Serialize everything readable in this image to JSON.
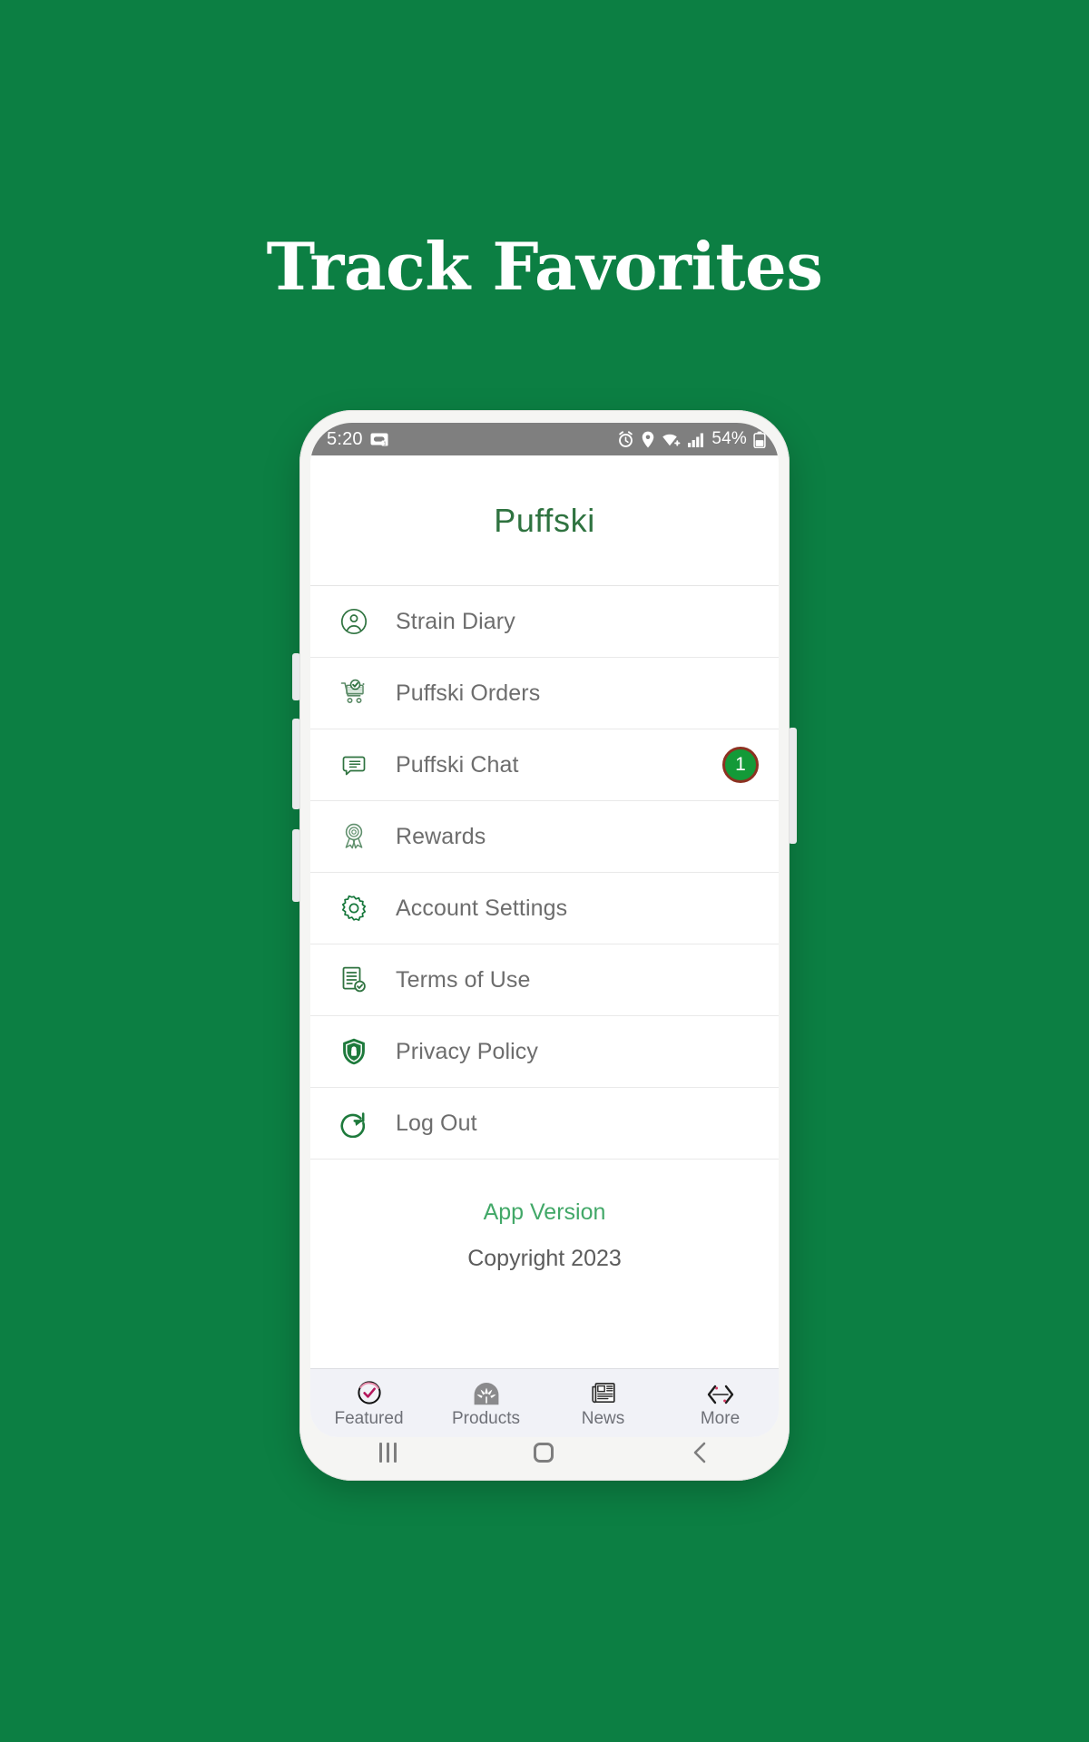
{
  "page": {
    "headline": "Track Favorites",
    "background_color": "#0c7f43"
  },
  "phone": {
    "statusbar": {
      "time": "5:20",
      "battery_text": "54%",
      "icons_left": [
        "voicemail-icon"
      ],
      "icons_right": [
        "alarm-icon",
        "location-icon",
        "wifi-icon",
        "signal-icon",
        "battery-icon"
      ]
    },
    "app": {
      "title": "Puffski",
      "title_color": "#2f7340",
      "menu": [
        {
          "label": "Strain Diary",
          "icon": "account-circle-icon",
          "badge": null
        },
        {
          "label": "Puffski Orders",
          "icon": "cart-check-icon",
          "badge": null
        },
        {
          "label": "Puffski Chat",
          "icon": "chat-bubble-icon",
          "badge": "1"
        },
        {
          "label": "Rewards",
          "icon": "award-ribbon-icon",
          "badge": null
        },
        {
          "label": "Account Settings",
          "icon": "gear-icon",
          "badge": null
        },
        {
          "label": "Terms of Use",
          "icon": "document-check-icon",
          "badge": null
        },
        {
          "label": "Privacy Policy",
          "icon": "shield-lock-icon",
          "badge": null
        },
        {
          "label": "Log Out",
          "icon": "logout-arrow-icon",
          "badge": null
        }
      ],
      "footer": {
        "version_link": "App Version",
        "copyright": "Copyright 2023"
      },
      "tabs": [
        {
          "label": "Featured",
          "icon": "check-circle-icon"
        },
        {
          "label": "Products",
          "icon": "cannabis-leaf-icon"
        },
        {
          "label": "News",
          "icon": "newspaper-icon"
        },
        {
          "label": "More",
          "icon": "chevron-left-right-icon"
        }
      ]
    },
    "navbar": {
      "recents": "recents-icon",
      "home": "home-icon",
      "back": "back-icon"
    }
  }
}
